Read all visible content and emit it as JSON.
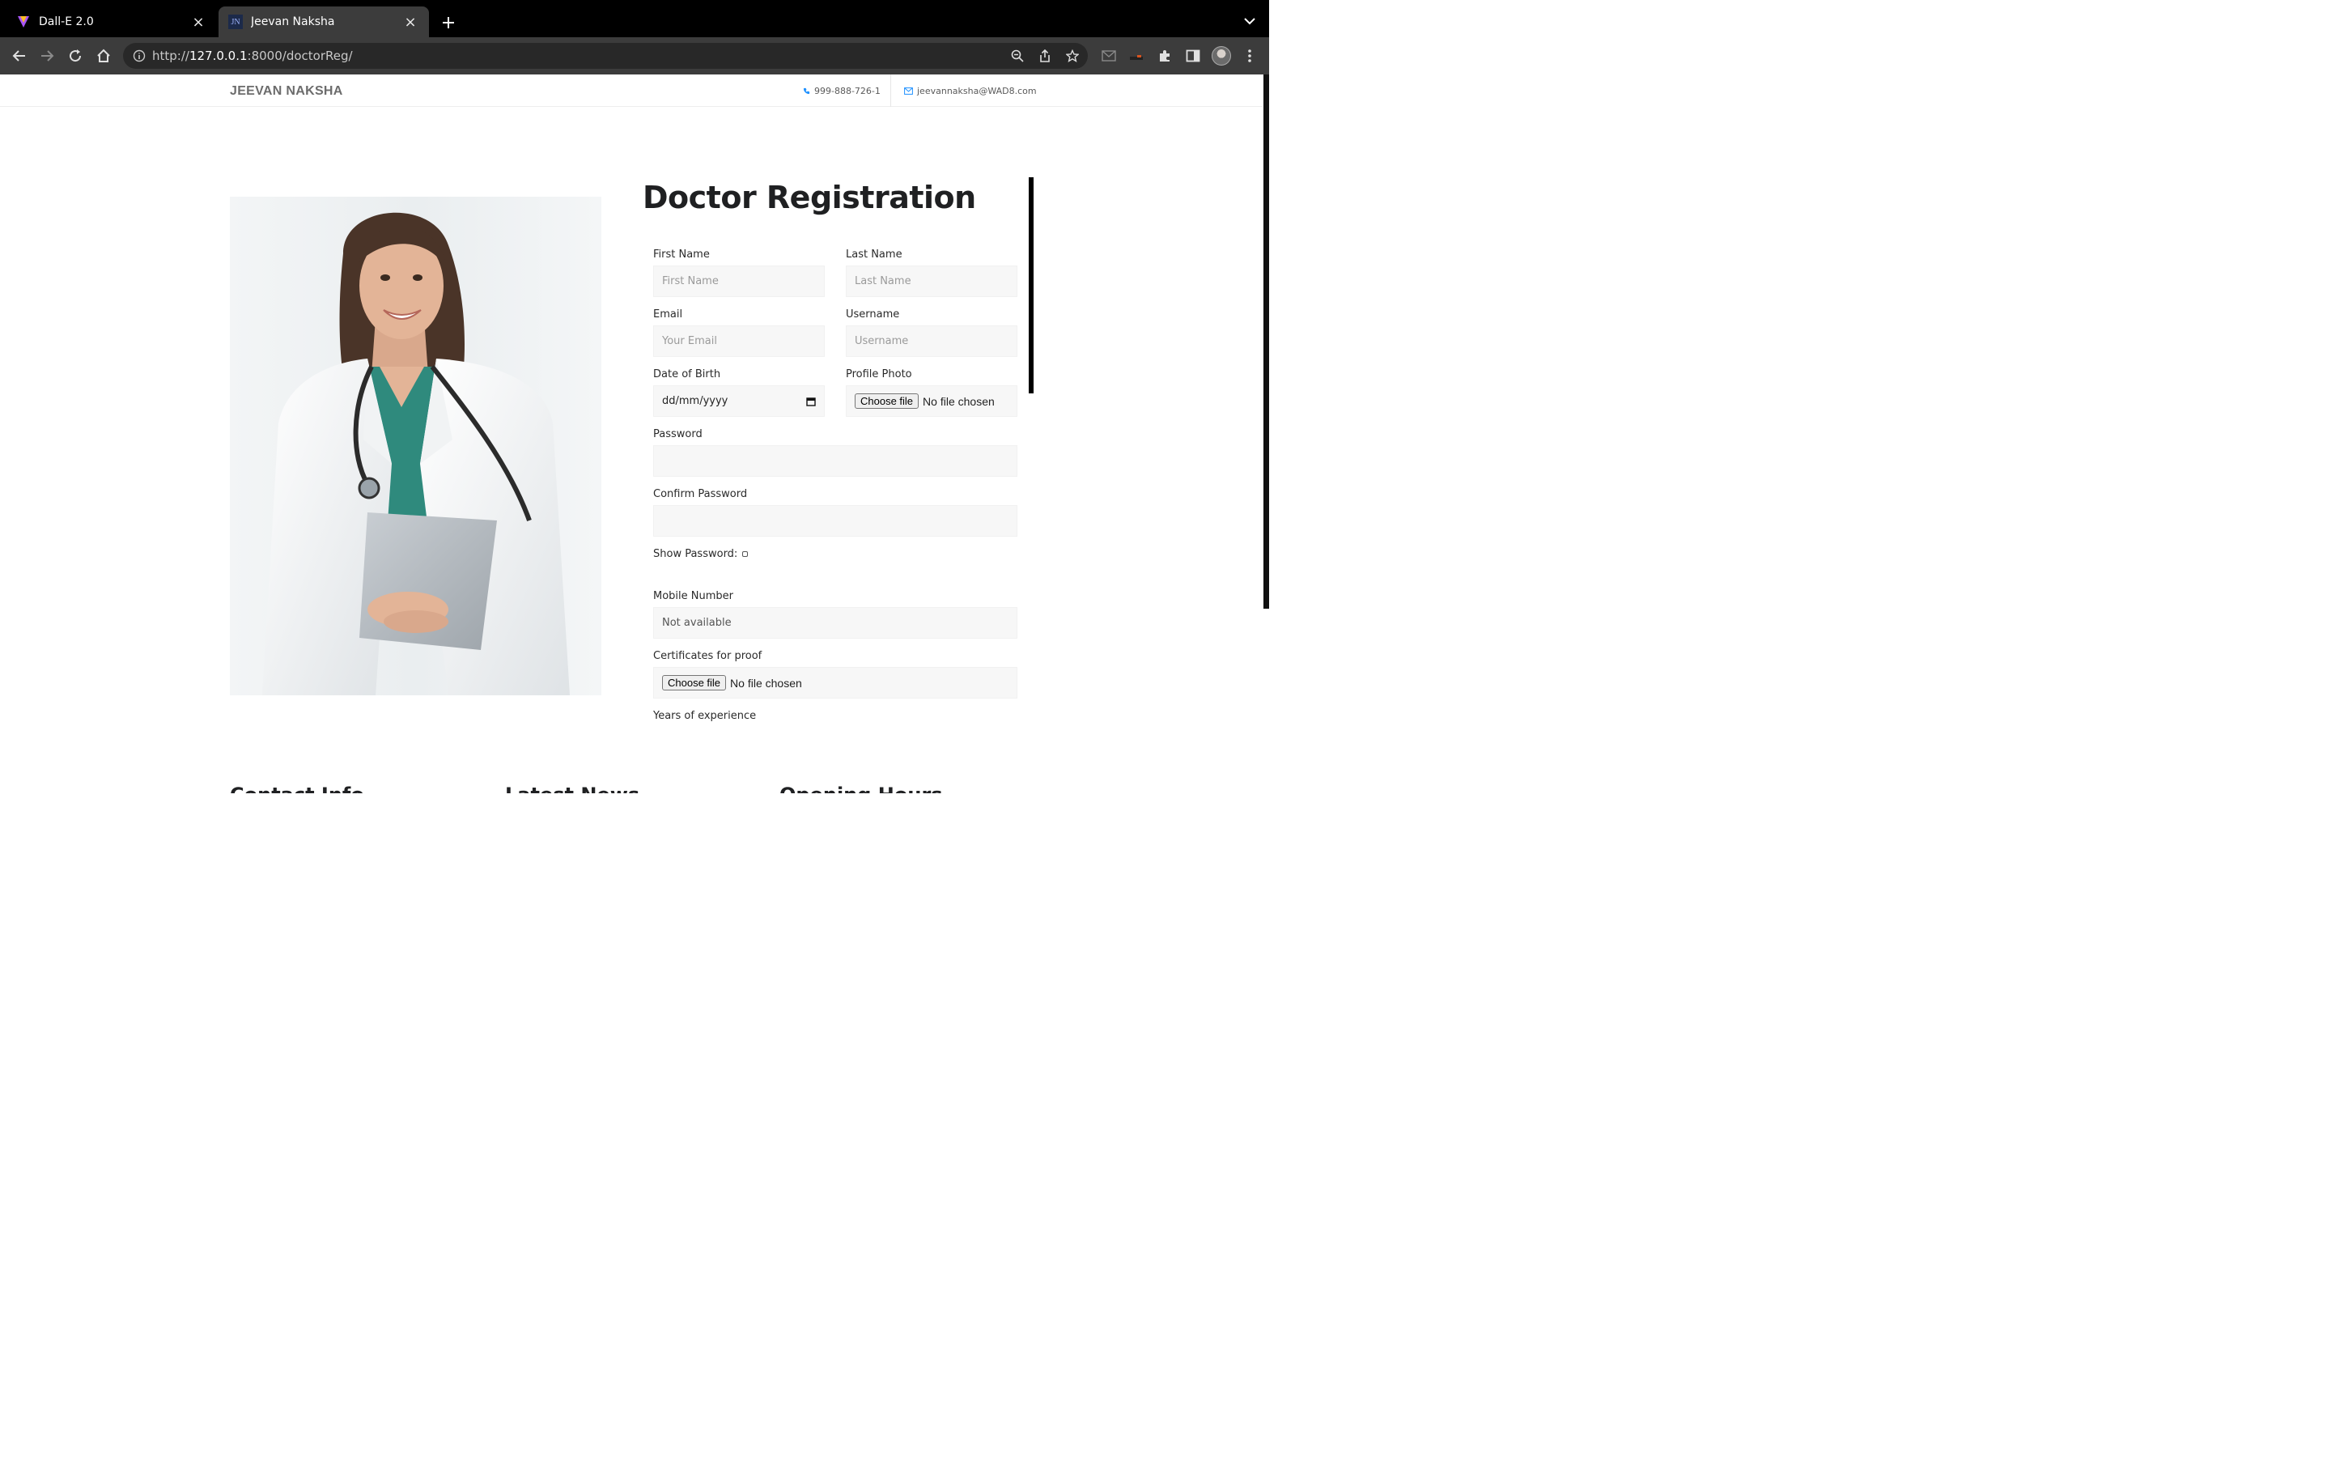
{
  "browser": {
    "tabs": [
      {
        "title": "Dall-E 2.0",
        "active": false
      },
      {
        "title": "Jeevan Naksha",
        "active": true
      }
    ],
    "favicon_text": "JN",
    "url_prefix": "http://",
    "url_host": "127.0.0.1",
    "url_rest": ":8000/doctorReg/"
  },
  "site": {
    "brand": "JEEVAN NAKSHA",
    "phone": "999-888-726-1",
    "email": "jeevannaksha@WAD8.com"
  },
  "form": {
    "heading": "Doctor Registration",
    "first_name_label": "First Name",
    "first_name_placeholder": "First Name",
    "last_name_label": "Last Name",
    "last_name_placeholder": "Last Name",
    "email_label": "Email",
    "email_placeholder": "Your Email",
    "username_label": "Username",
    "username_placeholder": "Username",
    "dob_label": "Date of Birth",
    "dob_placeholder": "dd/mm/yyyy",
    "photo_label": "Profile Photo",
    "choose_file": "Choose file",
    "no_file": "No file chosen",
    "password_label": "Password",
    "confirm_password_label": "Confirm Password",
    "show_password_label": "Show Password:",
    "mobile_label": "Mobile Number",
    "mobile_value": "Not available",
    "certificates_label": "Certificates for proof",
    "experience_label": "Years of experience"
  },
  "footer": {
    "col1": "Contact Info",
    "col2": "Latest News",
    "col3": "Opening Hours"
  },
  "colors": {
    "accent": "#1e90ff",
    "chrome_dark": "#000000",
    "chrome_toolbar": "#3c3c3c"
  }
}
